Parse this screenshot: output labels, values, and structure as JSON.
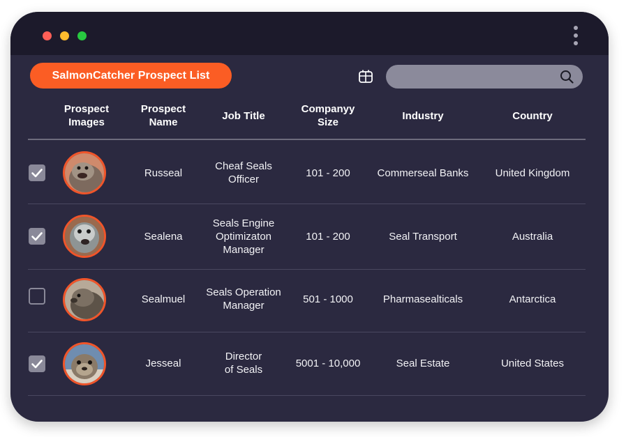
{
  "window": {
    "title_pill": "SalmonCatcher Prospect List",
    "search": {
      "value": "",
      "placeholder": ""
    }
  },
  "icons": {
    "window_controls": [
      "close-dot",
      "minimize-dot",
      "maximize-dot"
    ],
    "menu": "kebab-menu-icon",
    "calendar": "calendar-icon",
    "search": "search-icon"
  },
  "colors": {
    "accent": "#fb5d24",
    "window_bg": "#2b2940",
    "titlebar_bg": "#1c1a2b",
    "search_bg": "#8b8a9b",
    "checkbox": "#8a8999",
    "avatar_ring": "#f0552a"
  },
  "table": {
    "columns": [
      "Prospect\nImages",
      "Prospect\nName",
      "Job Title",
      "Companyy\nSize",
      "Industry",
      "Country"
    ],
    "rows": [
      {
        "checked": true,
        "image": "seal-photo",
        "name": "Russeal",
        "job_title": "Cheaf Seals\nOfficer",
        "company_size": "101 - 200",
        "industry": "Commerseal Banks",
        "country": "United Kingdom"
      },
      {
        "checked": true,
        "image": "seal-photo",
        "name": "Sealena",
        "job_title": "Seals Engine\nOptimizaton\nManager",
        "company_size": "101 - 200",
        "industry": "Seal Transport",
        "country": "Australia"
      },
      {
        "checked": false,
        "image": "seal-photo",
        "name": "Sealmuel",
        "job_title": "Seals Operation\nManager",
        "company_size": "501 - 1000",
        "industry": "Pharmasealticals",
        "country": "Antarctica"
      },
      {
        "checked": true,
        "image": "seal-photo",
        "name": "Jesseal",
        "job_title": "Director\nof Seals",
        "company_size": "5001 - 10,000",
        "industry": "Seal Estate",
        "country": "United States"
      }
    ]
  }
}
